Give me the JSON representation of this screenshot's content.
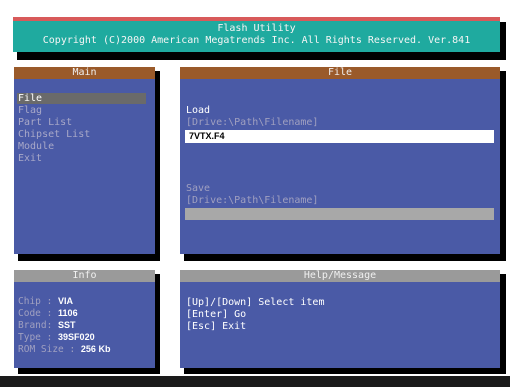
{
  "header": {
    "title": "Flash Utility",
    "copyright": "Copyright (C)2000 American Megatrends Inc. All Rights Reserved. Ver.841"
  },
  "main_panel": {
    "title": "Main",
    "items": [
      {
        "label": "File",
        "active": true
      },
      {
        "label": "Flag",
        "active": false
      },
      {
        "label": "Part List",
        "active": false
      },
      {
        "label": "Chipset List",
        "active": false
      },
      {
        "label": "Module",
        "active": false
      },
      {
        "label": "Exit",
        "active": false
      }
    ]
  },
  "file_panel": {
    "title": "File",
    "load_label": "Load",
    "load_hint": "[Drive:\\Path\\Filename]",
    "load_value": "7VTX.F4",
    "save_label": "Save",
    "save_hint": "[Drive:\\Path\\Filename]",
    "save_value": ""
  },
  "info_panel": {
    "title": "Info",
    "rows": [
      {
        "key": "Chip  : ",
        "value": "VIA"
      },
      {
        "key": "Code  : ",
        "value": "1106"
      },
      {
        "key": "Brand: ",
        "value": "SST"
      },
      {
        "key": "Type  : ",
        "value": "39SF020"
      },
      {
        "key": "ROM Size : ",
        "value": "256 Kb"
      }
    ]
  },
  "help_panel": {
    "title": "Help/Message",
    "lines": [
      "[Up]/[Down] Select item",
      "[Enter] Go",
      "[Esc] Exit"
    ]
  },
  "colors": {
    "panel_bg": "#4a5aa6",
    "title_bg": "#1faa9f",
    "header_brown": "#9a5a2a",
    "header_gray": "#9a9a9a",
    "highlight": "#6a6a6a"
  }
}
